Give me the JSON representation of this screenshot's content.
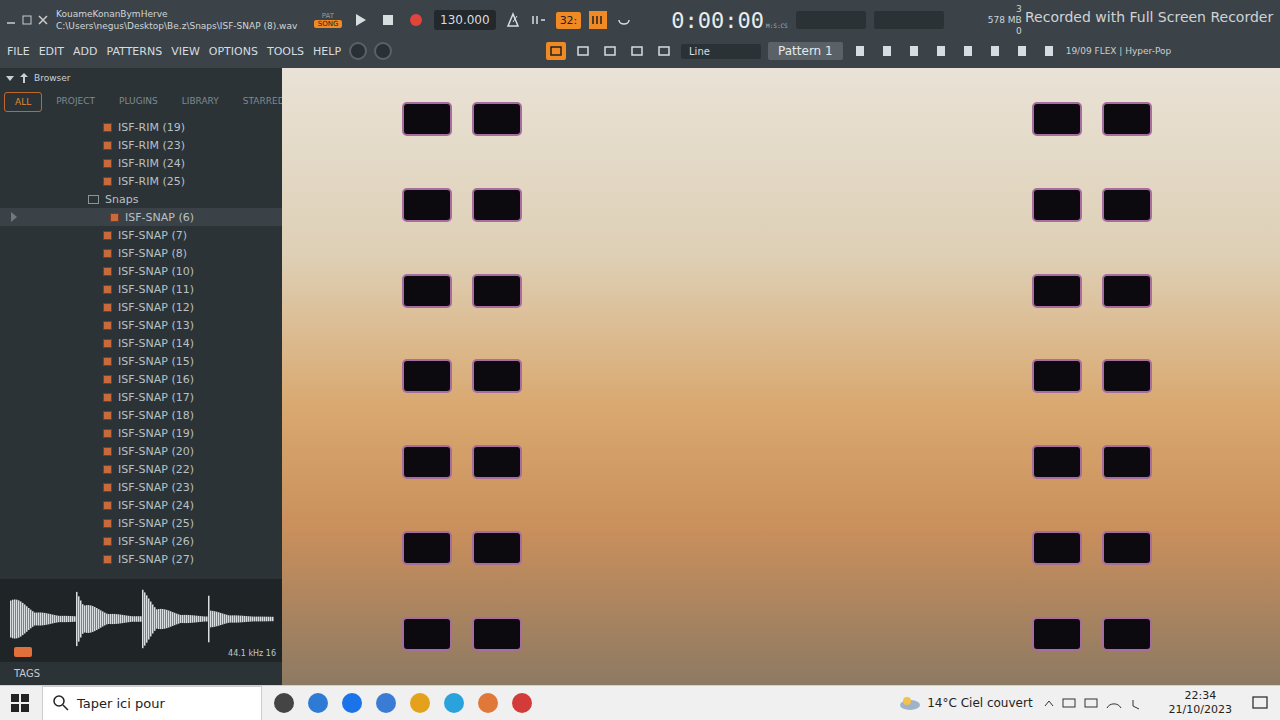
{
  "window": {
    "title": "KouameKonanBymHerve",
    "path": "C:\\Users\\negus\\Desktop\\Be.z\\Snaps\\ISF-SNAP (8).wav"
  },
  "transport": {
    "modes": [
      {
        "label": "PAT",
        "selected": false
      },
      {
        "label": "SONG",
        "selected": true
      }
    ],
    "tempo": "130.000",
    "snap": "32:",
    "time": "0:00:00",
    "time_unit": "M:S:CS",
    "cpu": "3",
    "memory": "578 MB",
    "voices": "0"
  },
  "watermark": "Recorded with Full Screen Recorder",
  "menu": [
    "FILE",
    "EDIT",
    "ADD",
    "PATTERNS",
    "VIEW",
    "OPTIONS",
    "TOOLS",
    "HELP"
  ],
  "toolbar": {
    "snap_mode": "Line",
    "pattern": "Pattern 1",
    "hint": "19/09  FLEX | Hyper-Pop"
  },
  "browser": {
    "title": "Browser",
    "tabs": [
      {
        "label": "ALL",
        "selected": true
      },
      {
        "label": "PROJECT",
        "selected": false
      },
      {
        "label": "PLUGINS",
        "selected": false
      },
      {
        "label": "LIBRARY",
        "selected": false
      },
      {
        "label": "STARRED",
        "selected": false
      }
    ],
    "items": [
      {
        "label": "ISF-RIM (19)",
        "kind": "file",
        "selected": false
      },
      {
        "label": "ISF-RIM (23)",
        "kind": "file",
        "selected": false
      },
      {
        "label": "ISF-RIM (24)",
        "kind": "file",
        "selected": false
      },
      {
        "label": "ISF-RIM (25)",
        "kind": "file",
        "selected": false
      },
      {
        "label": "Snaps",
        "kind": "folder",
        "selected": false
      },
      {
        "label": "ISF-SNAP (6)",
        "kind": "file",
        "selected": true
      },
      {
        "label": "ISF-SNAP (7)",
        "kind": "file",
        "selected": false
      },
      {
        "label": "ISF-SNAP (8)",
        "kind": "file",
        "selected": false
      },
      {
        "label": "ISF-SNAP (10)",
        "kind": "file",
        "selected": false
      },
      {
        "label": "ISF-SNAP (11)",
        "kind": "file",
        "selected": false
      },
      {
        "label": "ISF-SNAP (12)",
        "kind": "file",
        "selected": false
      },
      {
        "label": "ISF-SNAP (13)",
        "kind": "file",
        "selected": false
      },
      {
        "label": "ISF-SNAP (14)",
        "kind": "file",
        "selected": false
      },
      {
        "label": "ISF-SNAP (15)",
        "kind": "file",
        "selected": false
      },
      {
        "label": "ISF-SNAP (16)",
        "kind": "file",
        "selected": false
      },
      {
        "label": "ISF-SNAP (17)",
        "kind": "file",
        "selected": false
      },
      {
        "label": "ISF-SNAP (18)",
        "kind": "file",
        "selected": false
      },
      {
        "label": "ISF-SNAP (19)",
        "kind": "file",
        "selected": false
      },
      {
        "label": "ISF-SNAP (20)",
        "kind": "file",
        "selected": false
      },
      {
        "label": "ISF-SNAP (22)",
        "kind": "file",
        "selected": false
      },
      {
        "label": "ISF-SNAP (23)",
        "kind": "file",
        "selected": false
      },
      {
        "label": "ISF-SNAP (24)",
        "kind": "file",
        "selected": false
      },
      {
        "label": "ISF-SNAP (25)",
        "kind": "file",
        "selected": false
      },
      {
        "label": "ISF-SNAP (26)",
        "kind": "file",
        "selected": false
      },
      {
        "label": "ISF-SNAP (27)",
        "kind": "file",
        "selected": false
      }
    ],
    "waveform": {
      "info": "44.1 kHz 16"
    },
    "tags": "TAGS"
  },
  "taskbar": {
    "search": "Taper ici pour",
    "weather": "14°C Ciel couvert",
    "time": "22:34",
    "date": "21/10/2023"
  }
}
